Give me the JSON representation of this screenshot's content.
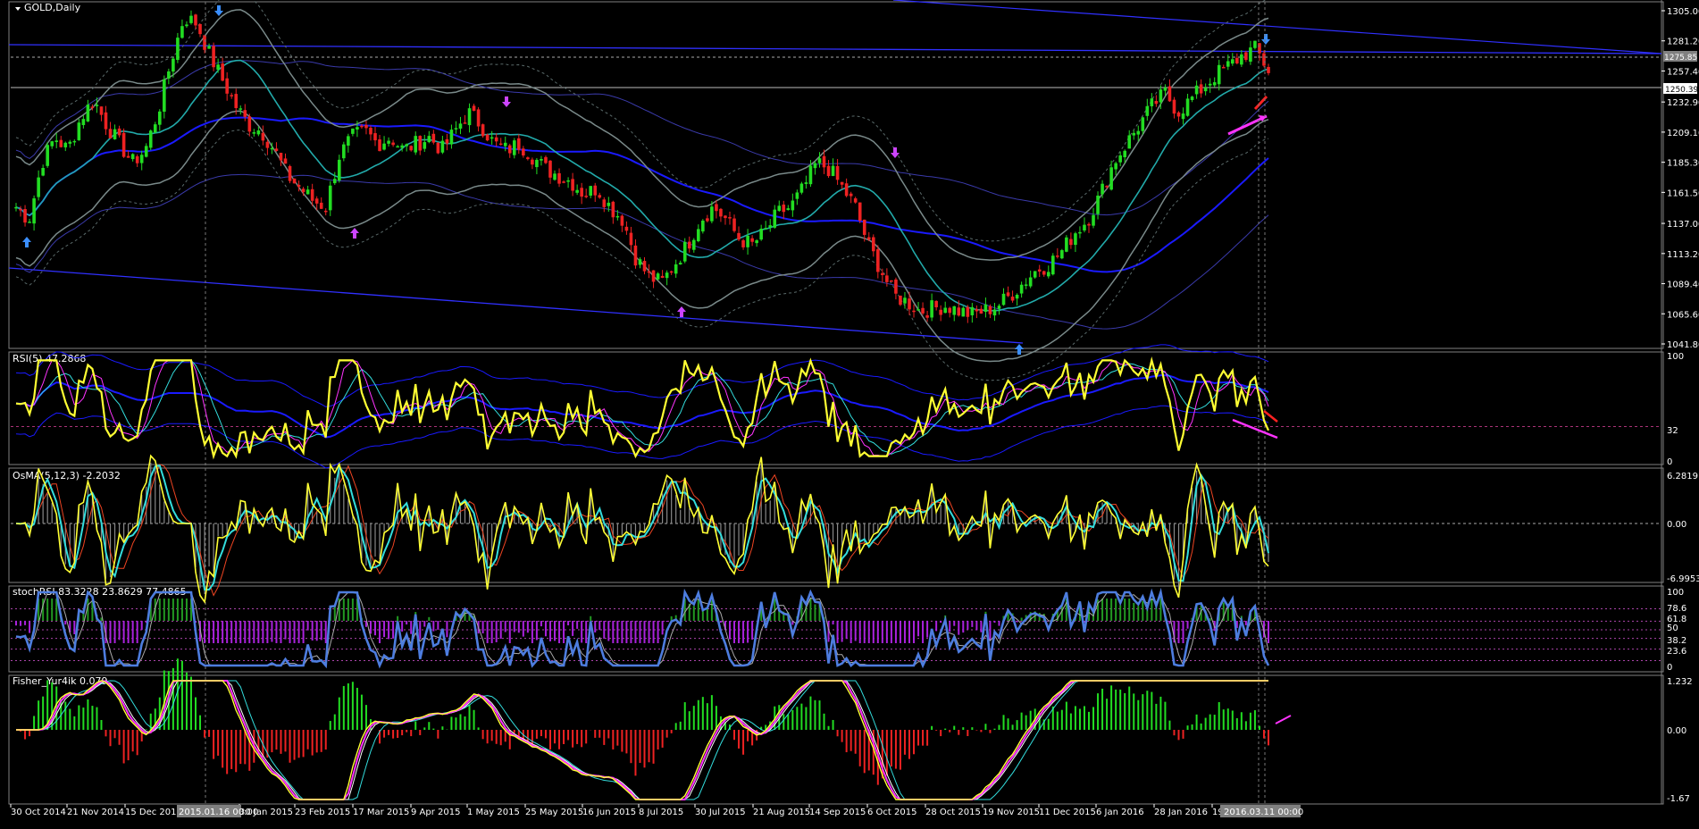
{
  "window": {
    "title": "GOLD,Daily"
  },
  "chart_data": [
    {
      "type": "line",
      "panel": "price",
      "title": "GOLD,Daily",
      "y_ticks": [
        "1305.00",
        "1281.20",
        "1257.40",
        "1232.90",
        "1209.10",
        "1185.30",
        "1161.50",
        "1137.00",
        "1113.20",
        "1089.40",
        "1065.60",
        "1041.80"
      ],
      "ylim": [
        1041.8,
        1305.0
      ],
      "price_marker_1": "1275.85",
      "price_marker_2": "1250.39",
      "grid": false,
      "series": [
        {
          "values": [
            1150,
            1140,
            1185,
            1205,
            1195,
            1220,
            1235,
            1215,
            1200,
            1185,
            1195,
            1225,
            1265,
            1300,
            1295,
            1270,
            1250,
            1230,
            1215,
            1210,
            1195,
            1175,
            1165,
            1155,
            1150,
            1190,
            1205,
            1210,
            1200,
            1205,
            1195,
            1200,
            1205,
            1195,
            1210,
            1225,
            1215,
            1200,
            1195,
            1200,
            1190,
            1180,
            1175,
            1170,
            1160,
            1165,
            1150,
            1140,
            1110,
            1095,
            1090,
            1105,
            1120,
            1140,
            1150,
            1140,
            1125,
            1120,
            1130,
            1145,
            1150,
            1165,
            1185,
            1180,
            1165,
            1150,
            1120,
            1100,
            1080,
            1075,
            1068,
            1070,
            1072,
            1068,
            1065,
            1068,
            1072,
            1080,
            1090,
            1100,
            1105,
            1115,
            1130,
            1140,
            1160,
            1185,
            1200,
            1215,
            1230,
            1240,
            1225,
            1235,
            1245,
            1255,
            1262,
            1270,
            1275,
            1258
          ]
        }
      ]
    },
    {
      "type": "line",
      "panel": "rsi",
      "title": "RSI(5) 47.2868",
      "y_ticks": [
        "100",
        "32",
        "0"
      ],
      "ylim": [
        0,
        100
      ]
    },
    {
      "type": "line",
      "panel": "osma",
      "title": "OsMA(5,12,3) -2.2032",
      "y_ticks": [
        "6.2819",
        "0.00",
        "-6.9953"
      ],
      "ylim": [
        -6.9953,
        6.2819
      ]
    },
    {
      "type": "bar",
      "panel": "stochrsi",
      "title": "stochRSI 83.3228 23.8629 77.4865",
      "y_ticks": [
        "100",
        "78.6",
        "61.8",
        "50",
        "38.2",
        "23.6",
        "0"
      ],
      "ylim": [
        0,
        100
      ]
    },
    {
      "type": "bar",
      "panel": "fisher",
      "title": "Fisher_Yur4ik 0.079",
      "y_ticks": [
        "1.232",
        "0.00",
        "-1.67"
      ],
      "ylim": [
        -1.67,
        1.232
      ]
    }
  ],
  "x_axis": {
    "dates": [
      "30 Oct 2014",
      "21 Nov 2014",
      "15 Dec 2014",
      "",
      "30 Jan 2015",
      "23 Feb 2015",
      "17 Mar 2015",
      "9 Apr 2015",
      "1 May 2015",
      "25 May 2015",
      "16 Jun 2015",
      "8 Jul 2015",
      "30 Jul 2015",
      "21 Aug 2015",
      "14 Sep 2015",
      "6 Oct 2015",
      "28 Oct 2015",
      "19 Nov 2015",
      "11 Dec 2015",
      "6 Jan 2016",
      "28 Jan 2016",
      "19",
      ""
    ],
    "highlight_1": "2015.01.16 00:00",
    "highlight_2": "2016.03.11 00:00"
  },
  "colors": {
    "background": "#000000",
    "bull": "#22dd22",
    "bear": "#ee2222",
    "ma_teal": "#22aaaa",
    "ma_blue": "#1a1aff",
    "band_gray": "#7a8a8a",
    "rsi_yellow": "#ffff33",
    "cyan": "#33dddd",
    "magenta": "#ff33ff",
    "purple": "#aa22dd",
    "green_hist": "#229922",
    "stoch_blue": "#4d7ddf",
    "axis_text": "#ffffff"
  }
}
